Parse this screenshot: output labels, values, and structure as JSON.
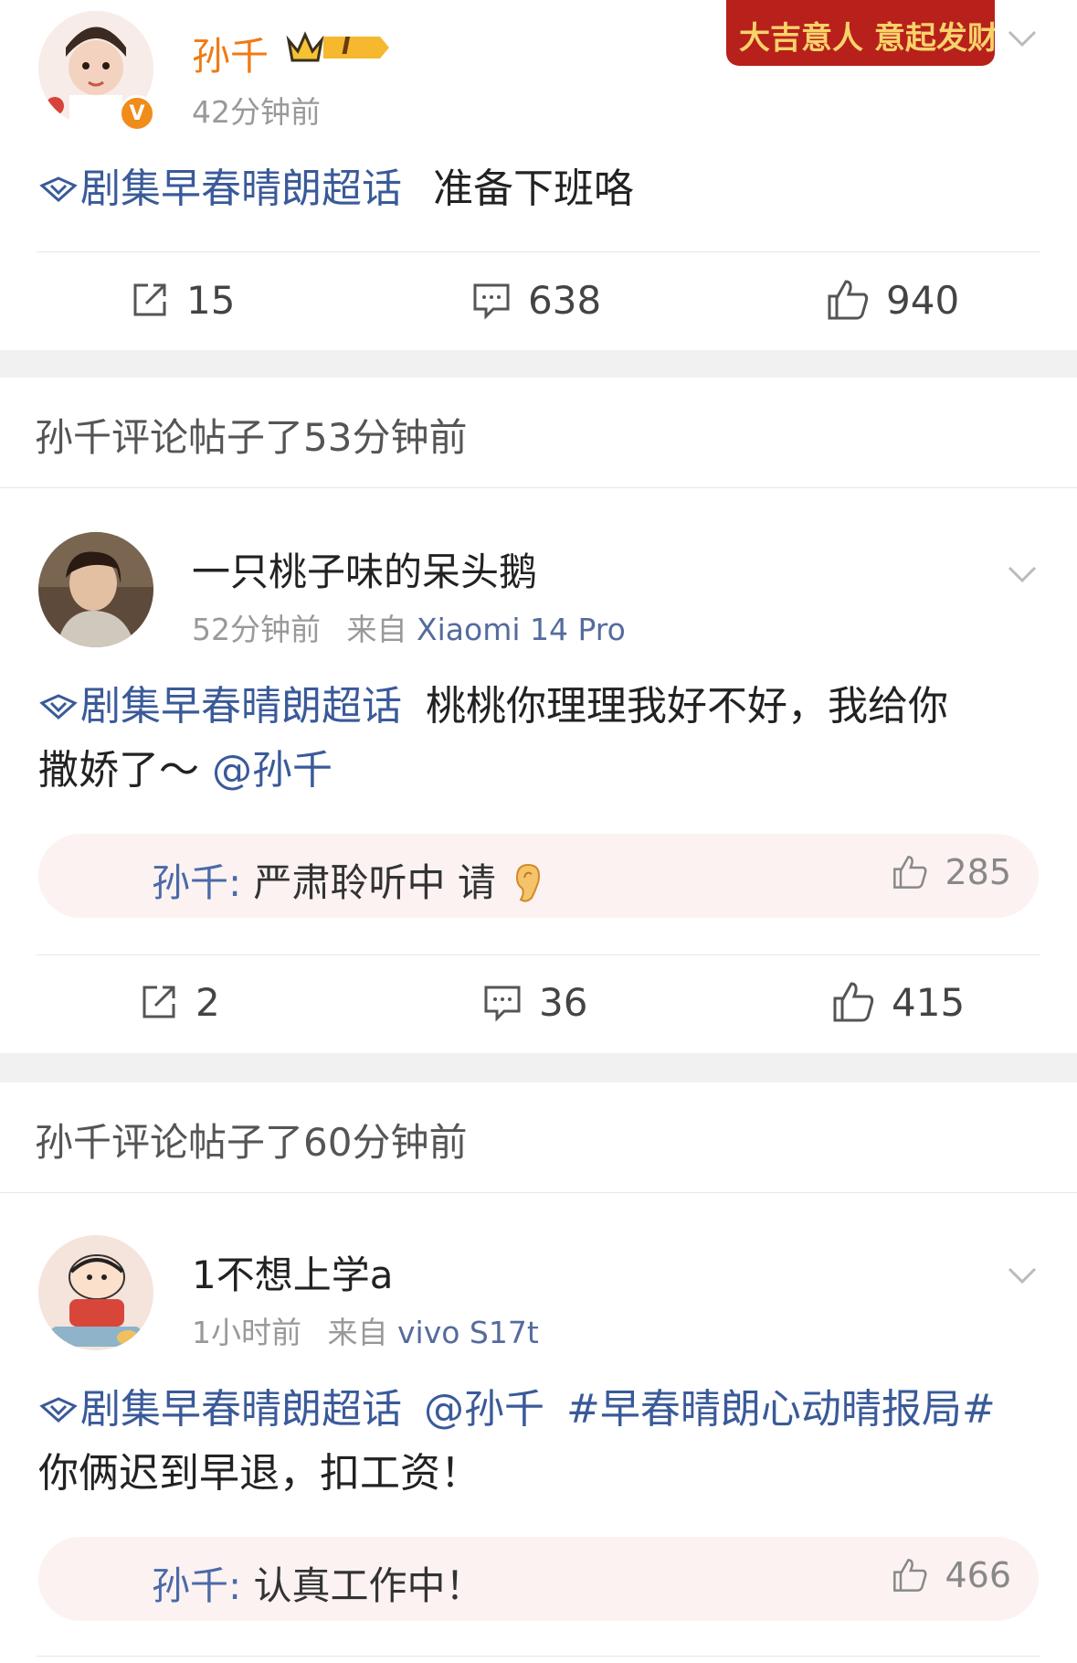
{
  "post1": {
    "username": "孙千",
    "badge_level": "I",
    "time": "42分钟前",
    "banner_text": "大吉意人 意起发财",
    "topic": "剧集早春晴朗超话",
    "content": "准备下班咯",
    "reposts": "15",
    "comments": "638",
    "likes": "940"
  },
  "section1": {
    "header": "孙千评论帖子了53分钟前"
  },
  "post2": {
    "username": "一只桃子味的呆头鹅",
    "time": "52分钟前",
    "source_prefix": "来自",
    "source": "Xiaomi 14 Pro",
    "topic": "剧集早春晴朗超话",
    "content_line1": "桃桃你理理我好不好，我给你",
    "content_line2": "撒娇了～",
    "mention": "@孙千",
    "reply_name": "孙千",
    "reply_colon": ":",
    "reply_text": "严肃聆听中 请",
    "reply_likes": "285",
    "reposts": "2",
    "comments": "36",
    "likes": "415"
  },
  "section2": {
    "header": "孙千评论帖子了60分钟前"
  },
  "post3": {
    "username": "1不想上学a",
    "time": "1小时前",
    "source_prefix": "来自",
    "source": "vivo S17t",
    "topic": "剧集早春晴朗超话",
    "mention": "@孙千",
    "hashtag": "#早春晴朗心动晴报局#",
    "content_line2": "你俩迟到早退，扣工资！",
    "reply_name": "孙千",
    "reply_colon": ":",
    "reply_text": "认真工作中！",
    "reply_likes": "466"
  },
  "colors": {
    "link": "#3a5a99",
    "username_orange": "#f07a14",
    "gap": "#f1f1f1"
  }
}
